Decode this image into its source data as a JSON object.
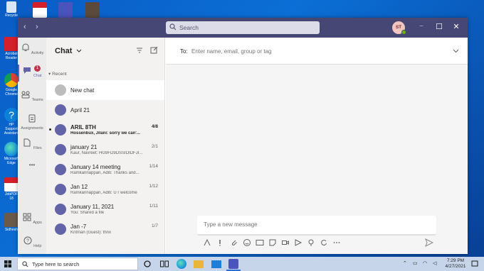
{
  "desktop": {
    "icons": [
      {
        "label": "Recycle",
        "color": "#d9e6f5"
      },
      {
        "label": "Acrobat Reader",
        "color": "#d4202a"
      },
      {
        "label": "Google Chrome",
        "color": "#e8b73a"
      },
      {
        "label": "HP Support Assistant",
        "color": "#0c7fd9"
      },
      {
        "label": "Microsoft Edge",
        "color": "#1e9bd9"
      },
      {
        "label": "JobPDF 18",
        "color": "#d4202a"
      },
      {
        "label": "Sidhesh",
        "color": "#6b5a4a"
      }
    ]
  },
  "window": {
    "search_placeholder": "Search",
    "user_initials": "ST",
    "nav_back": "‹",
    "nav_forward": "›",
    "controls": {
      "more": "•••",
      "minimize": "—",
      "maximize": "☐",
      "close": "✕"
    }
  },
  "rail": {
    "items": [
      {
        "label": "Activity",
        "icon": "bell-icon"
      },
      {
        "label": "Chat",
        "icon": "chat-icon",
        "badge": "1"
      },
      {
        "label": "Teams",
        "icon": "teams-icon"
      },
      {
        "label": "Assignments",
        "icon": "assignments-icon"
      },
      {
        "label": "Files",
        "icon": "files-icon"
      },
      {
        "label": "•••",
        "icon": "more-icon"
      },
      {
        "label": "Apps",
        "icon": "apps-icon"
      },
      {
        "label": "Help",
        "icon": "help-icon"
      }
    ]
  },
  "chatlist": {
    "title": "Chat",
    "section": "Recent",
    "rows": [
      {
        "name": "New chat",
        "sub": "",
        "date": "",
        "type": "newchat"
      },
      {
        "name": "April 21",
        "sub": "",
        "date": "",
        "type": "group"
      },
      {
        "name": "ARIL 8TH",
        "sub": "Hossenbux, Jilani: sorry we can'...",
        "date": "4/8",
        "type": "group",
        "unread": true
      },
      {
        "name": "january 21",
        "sub": "Kaur, Navreet: HG9FD9DSSIDIDFJI...",
        "date": "2/1",
        "type": "group"
      },
      {
        "name": "January 14 meeting",
        "sub": "Ramkannappan, Aditi: Thanks and...",
        "date": "1/14",
        "type": "group"
      },
      {
        "name": "Jan 12",
        "sub": "Ramkannappan, Aditi: U r welcome",
        "date": "1/12",
        "type": "group"
      },
      {
        "name": "January 11, 2021",
        "sub": "You: Shared a file",
        "date": "1/11",
        "type": "group"
      },
      {
        "name": "Jan -7",
        "sub": "Kritman (Guest): thnx",
        "date": "1/7",
        "type": "group"
      }
    ]
  },
  "main": {
    "to_label": "To:",
    "to_placeholder": "Enter name, email, group or tag",
    "compose_placeholder": "Type a new message"
  },
  "taskbar": {
    "search_placeholder": "Type here to search",
    "time": "7:29 PM",
    "date": "4/27/2021",
    "accent": "#2b6fd6"
  },
  "colors": {
    "teams_purple": "#6264a7",
    "titlebar": "#464775"
  }
}
